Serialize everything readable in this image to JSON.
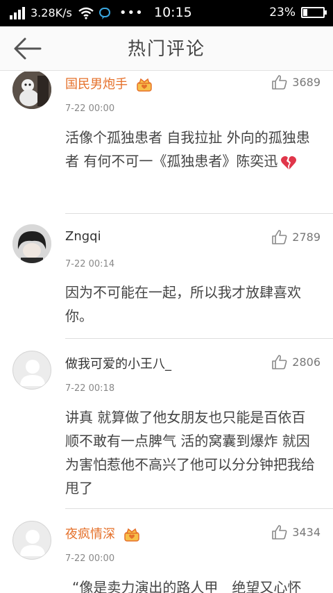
{
  "status_bar": {
    "speed": "3.28K/s",
    "time": "10:15",
    "battery": "23%",
    "battery_level": 0.23,
    "icons": [
      "signal-icon",
      "wifi-icon",
      "message-icon",
      "more-icon",
      "battery-icon"
    ]
  },
  "header": {
    "title": "热门评论",
    "back_icon": "back-arrow-icon"
  },
  "comments": [
    {
      "username": "国民男炮手",
      "vip": true,
      "time": "7-22 00:00",
      "likes": "3689",
      "text": "活像个孤独患者 自我拉扯 外向的孤独患者 有何不可一《孤独患者》陈奕迅",
      "emoji": "broken-heart-icon"
    },
    {
      "username": "Zngqi",
      "vip": false,
      "time": "7-22 00:14",
      "likes": "2789",
      "text": "因为不可能在一起，所以我才放肆喜欢你。"
    },
    {
      "username": "做我可爱的小王八_",
      "vip": false,
      "time": "7-22 00:18",
      "likes": "2806",
      "text": "讲真 就算做了他女朋友也只能是百依百顺不敢有一点脾气 活的窝囊到爆炸 就因为害怕惹他不高兴了他可以分分钟把我给甩了"
    },
    {
      "username": "夜疯情深",
      "vip": true,
      "time": "7-22 00:00",
      "likes": "3434",
      "text": "“像是卖力演出的路人甲　绝望又心怀"
    }
  ],
  "colors": {
    "vip_name": "#e5702a",
    "status_bar": "#000000",
    "header_bg": "#fafafa"
  }
}
